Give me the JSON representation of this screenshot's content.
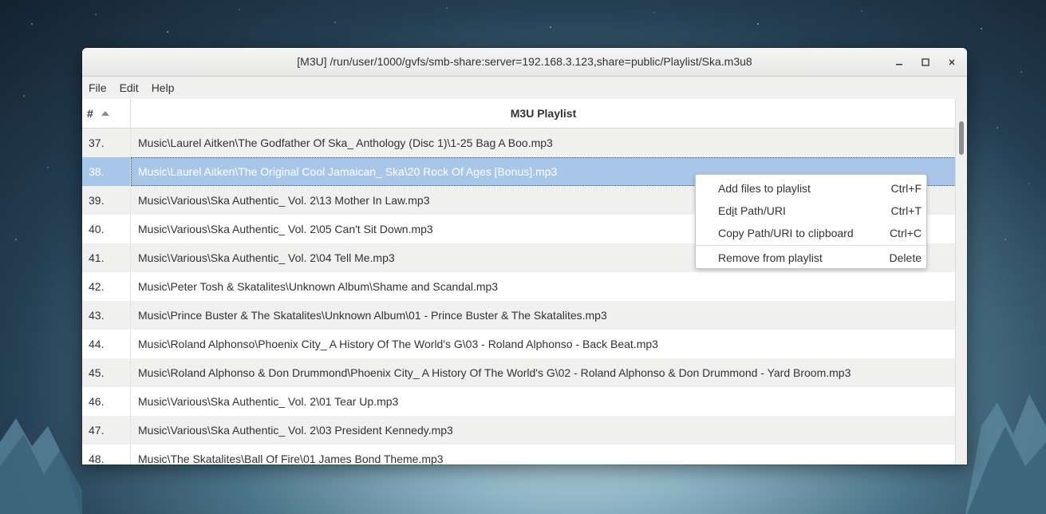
{
  "window": {
    "title": "[M3U] /run/user/1000/gvfs/smb-share:server=192.168.3.123,share=public/Playlist/Ska.m3u8",
    "controls": [
      "minimize-icon",
      "maximize-icon",
      "close-icon"
    ]
  },
  "menubar": {
    "items": [
      "File",
      "Edit",
      "Help"
    ]
  },
  "table": {
    "columns": {
      "number": "#",
      "path": "M3U Playlist"
    },
    "sort": "ascending",
    "selected_row": "38.",
    "rows": [
      {
        "num": "37.",
        "path": "Music\\Laurel Aitken\\The Godfather Of Ska_ Anthology (Disc 1)\\1-25 Bag A Boo.mp3"
      },
      {
        "num": "38.",
        "path": "Music\\Laurel Aitken\\The Original Cool Jamaican_ Ska\\20 Rock Of Ages [Bonus].mp3"
      },
      {
        "num": "39.",
        "path": "Music\\Various\\Ska Authentic_ Vol. 2\\13 Mother In Law.mp3"
      },
      {
        "num": "40.",
        "path": "Music\\Various\\Ska Authentic_ Vol. 2\\05 Can't Sit Down.mp3"
      },
      {
        "num": "41.",
        "path": "Music\\Various\\Ska Authentic_ Vol. 2\\04 Tell Me.mp3"
      },
      {
        "num": "42.",
        "path": "Music\\Peter Tosh & Skatalites\\Unknown Album\\Shame and Scandal.mp3"
      },
      {
        "num": "43.",
        "path": "Music\\Prince Buster & The Skatalites\\Unknown Album\\01 - Prince Buster & The Skatalites.mp3"
      },
      {
        "num": "44.",
        "path": "Music\\Roland Alphonso\\Phoenix City_ A History Of The World's G\\03 - Roland Alphonso - Back Beat.mp3"
      },
      {
        "num": "45.",
        "path": "Music\\Roland Alphonso & Don Drummond\\Phoenix City_ A History Of The World's G\\02 - Roland Alphonso & Don Drummond - Yard Broom.mp3"
      },
      {
        "num": "46.",
        "path": "Music\\Various\\Ska Authentic_ Vol. 2\\01 Tear Up.mp3"
      },
      {
        "num": "47.",
        "path": "Music\\Various\\Ska Authentic_ Vol. 2\\03 President Kennedy.mp3"
      },
      {
        "num": "48.",
        "path": "Music\\The Skatalites\\Ball Of Fire\\01 James Bond Theme.mp3"
      }
    ]
  },
  "context_menu": {
    "items": [
      {
        "pre": "Add files to playlist",
        "u": "",
        "post": "",
        "accel": "Ctrl+F"
      },
      {
        "pre": "Ed",
        "u": "i",
        "post": "t Path/URI",
        "accel": "Ctrl+T"
      },
      {
        "pre": "Copy Path/URI to clipboard",
        "u": "",
        "post": "",
        "accel": "Ctrl+C"
      },
      {
        "pre": "Remove from playlist",
        "u": "",
        "post": "",
        "accel": "Delete"
      }
    ]
  },
  "colors": {
    "selection": "#a7c6e8",
    "row_alt": "#f0f0ef",
    "text": "#2e3436"
  }
}
